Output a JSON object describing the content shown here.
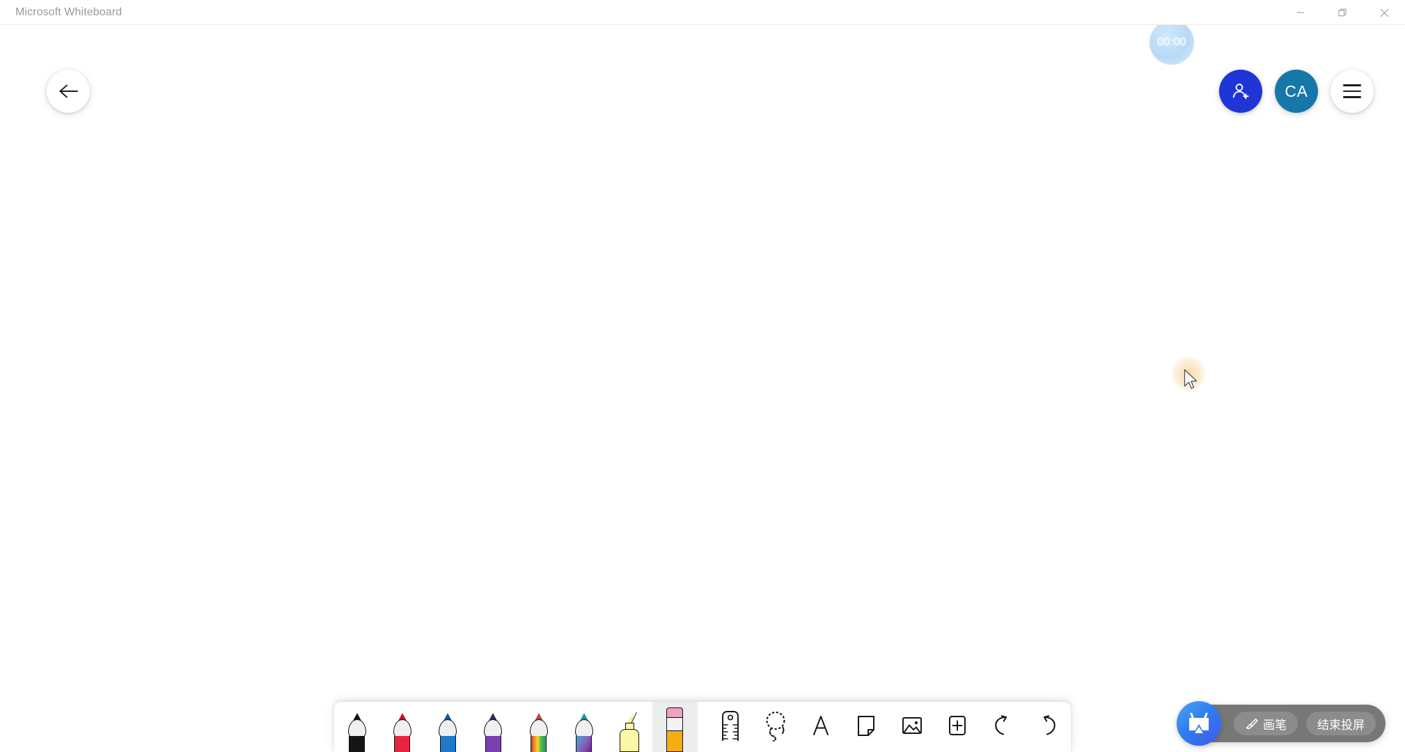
{
  "window": {
    "title": "Microsoft Whiteboard",
    "controls": [
      {
        "name": "minimize",
        "label": "Minimize"
      },
      {
        "name": "restore",
        "label": "Restore"
      },
      {
        "name": "close",
        "label": "Close"
      }
    ]
  },
  "colors": {
    "share_button": "#1f35d6",
    "avatar": "#1578a8",
    "timer_bubble": "#a8d1f5",
    "cast_widget": "#686868",
    "cast_logo": "#3f7ef0",
    "selected_tool_bg": "#eceded",
    "cursor_glow": "#f4c476"
  },
  "nav": {
    "back_button": {
      "icon": "arrow-left-icon",
      "label": "Back"
    }
  },
  "timer": {
    "value": "00:00"
  },
  "top_actions": [
    {
      "name": "share-button",
      "icon": "person-add-icon",
      "label": "Share"
    },
    {
      "name": "avatar-button",
      "icon": "avatar",
      "label": "CA"
    },
    {
      "name": "menu-button",
      "icon": "hamburger-icon",
      "label": "Menu"
    }
  ],
  "toolbar": {
    "selected": "eraser",
    "pens": [
      {
        "name": "pen-black",
        "label": "Black pen",
        "tip": "#111111",
        "body": "#1a1a1a"
      },
      {
        "name": "pen-red",
        "label": "Red pen",
        "tip": "#c4102c",
        "body": "#e8253f"
      },
      {
        "name": "pen-blue",
        "label": "Blue pen",
        "tip": "#12559c",
        "body": "#1f78c8"
      },
      {
        "name": "pen-purple",
        "label": "Purple pen",
        "tip": "#2b2a55",
        "body": "#7a3fb0"
      },
      {
        "name": "pen-rainbow",
        "label": "Rainbow pen",
        "tip": "#b34a3c",
        "body": "rainbow"
      },
      {
        "name": "pen-galaxy",
        "label": "Galaxy pen",
        "tip": "#1c8fa0",
        "body": "galaxy"
      }
    ],
    "highlighter": {
      "name": "highlighter",
      "label": "Highlighter",
      "color": "#fbf7a8"
    },
    "eraser": {
      "name": "eraser",
      "label": "Eraser",
      "cap": "#f0a0c0",
      "body": "#f5ad12"
    },
    "icon_tools": [
      {
        "name": "ruler-tool",
        "icon": "ruler-icon",
        "label": "Ruler"
      },
      {
        "name": "lasso-tool",
        "icon": "lasso-icon",
        "label": "Lasso select"
      },
      {
        "name": "text-tool",
        "icon": "text-a-icon",
        "label": "Text"
      },
      {
        "name": "note-tool",
        "icon": "note-icon",
        "label": "Sticky note"
      },
      {
        "name": "image-tool",
        "icon": "image-icon",
        "label": "Insert image"
      },
      {
        "name": "insert-tool",
        "icon": "plus-box-icon",
        "label": "Insert"
      },
      {
        "name": "undo-tool",
        "icon": "undo-icon",
        "label": "Undo"
      },
      {
        "name": "redo-tool",
        "icon": "redo-icon",
        "label": "Redo"
      }
    ]
  },
  "cast_widget": {
    "logo_label": "Screencast",
    "brush_label": "画笔",
    "end_label": "结束投屏"
  }
}
